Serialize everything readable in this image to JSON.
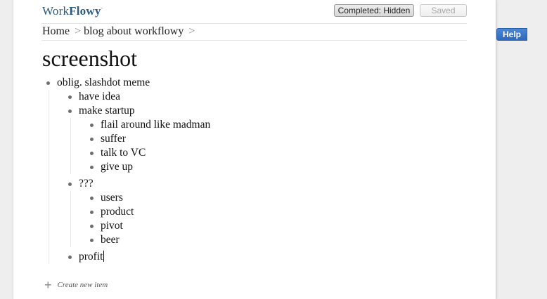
{
  "app": {
    "logo_regular": "Work",
    "logo_bold": "Flowy",
    "logo_mark": "·"
  },
  "toolbar": {
    "completed_label": "Completed: Hidden",
    "saved_label": "Saved"
  },
  "help": {
    "label": "Help"
  },
  "breadcrumb": {
    "items": [
      "Home",
      "blog about workflowy"
    ],
    "separator": ">"
  },
  "page": {
    "title": "screenshot"
  },
  "outline": {
    "items": [
      "oblig. slashdot meme",
      "have idea",
      "make startup",
      "flail around like madman",
      "suffer",
      "talk to VC",
      "give up",
      "???",
      "users",
      "product",
      "pivot",
      "beer",
      "profit"
    ]
  },
  "footer": {
    "create_label": "Create new item",
    "create_icon": "plus-icon"
  },
  "colors": {
    "logo": "#2a5b7f",
    "help_button": "#3a74c9",
    "bullet": "#6e6e6e"
  }
}
